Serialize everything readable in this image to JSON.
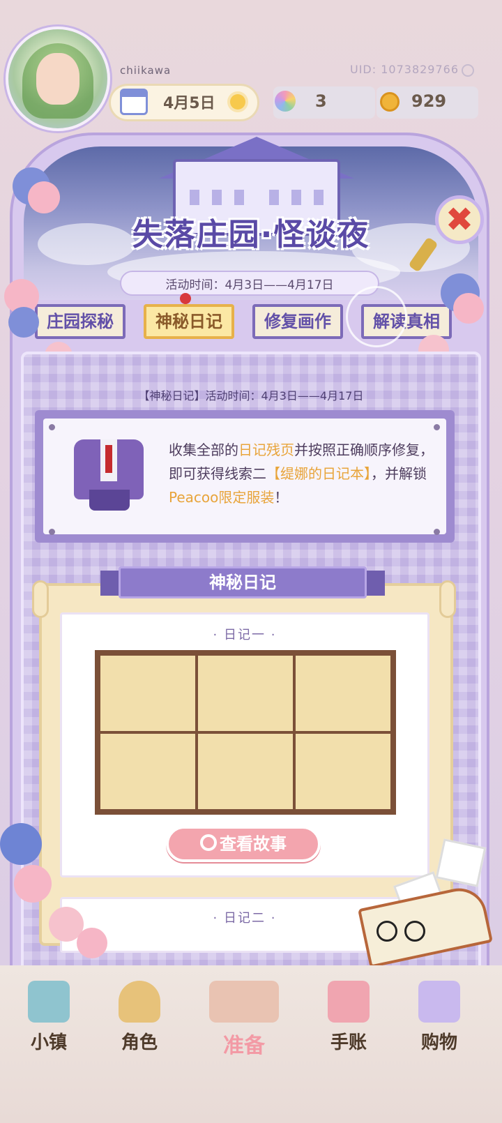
{
  "player": {
    "name": "chiikawa",
    "uid": "UID: 1073829766"
  },
  "hud": {
    "date": "4月5日",
    "weather_icon": "sun-icon",
    "resource1_value": "3",
    "resource2_value": "929"
  },
  "event": {
    "title": "失落庄园·怪谈夜",
    "time": "活动时间：4月3日——4月17日",
    "tabs": [
      {
        "label": "庄园探秘",
        "active": false
      },
      {
        "label": "神秘日记",
        "active": true
      },
      {
        "label": "修复画作",
        "active": false
      },
      {
        "label": "解读真相",
        "active": false
      }
    ]
  },
  "diary_page": {
    "sub_time": "【神秘日记】活动时间：4月3日——4月17日",
    "info": {
      "t1": "收集全部的",
      "h1": "日记残页",
      "t2": "并按照正确顺序修复，即可获得线索二",
      "h2": "【缇娜的日记本】",
      "t3": "，并解锁",
      "h3": "Peacoo限定服装",
      "t4": "！"
    },
    "section_title": "神秘日记",
    "diary1_title": "· 日记一 ·",
    "diary2_title": "· 日记二 ·",
    "story_button": "查看故事"
  },
  "nav": {
    "items": [
      {
        "label": "小镇"
      },
      {
        "label": "角色"
      },
      {
        "label": "准备"
      },
      {
        "label": "手账"
      },
      {
        "label": "购物"
      }
    ]
  },
  "colors": {
    "accent_purple": "#6250a8",
    "highlight_orange": "#e8a43a",
    "button_pink": "#f3a5ae"
  }
}
